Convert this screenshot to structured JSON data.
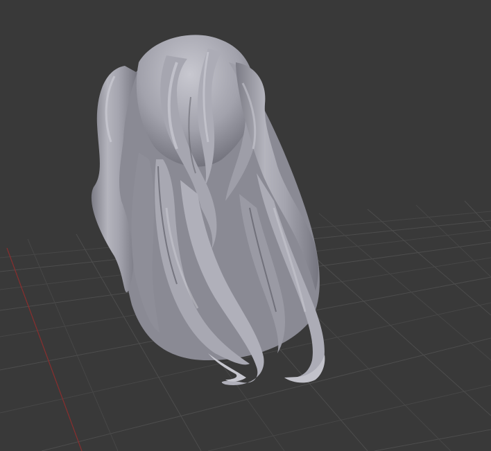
{
  "viewport": {
    "background": "#393939",
    "grid_color": "#474747",
    "grid_color_light": "#4d4d4d",
    "axis_x_color": "#8a2e2e",
    "model_base_color": "#9c9ca6",
    "model_light_color": "#c4c4cc",
    "model_shadow_color": "#5f5f69",
    "model_name": "hair-mesh"
  }
}
